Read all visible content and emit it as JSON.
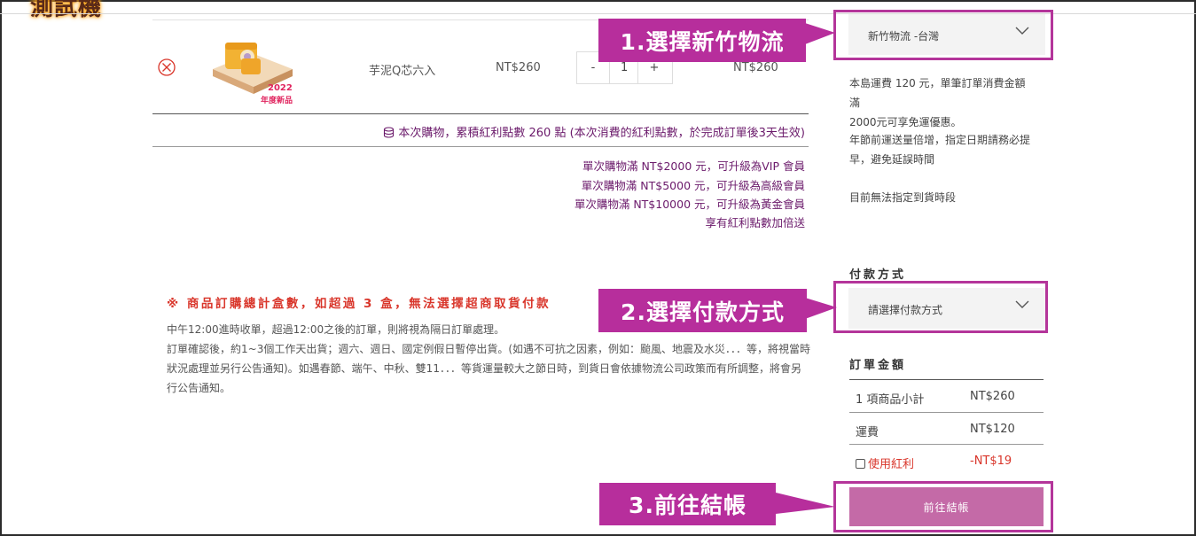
{
  "header": {
    "logo_text": "測試機"
  },
  "cart": {
    "item": {
      "badge_year": "2022",
      "badge_label": "年度新品",
      "name": "芋泥Q芯六入",
      "price": "NT$260",
      "qty_minus": "-",
      "qty_value": "1",
      "qty_plus": "+",
      "subtotal": "NT$260"
    },
    "points_text": "本次購物，累積紅利點數 260 點 (本次消費的紅利點數，於完成訂單後3天生效)",
    "promos": [
      "單次購物滿 NT$2000 元，可升級為VIP 會員",
      "單次購物滿 NT$5000 元，可升級為高級會員",
      "單次購物滿 NT$10000 元，可升級為黃金會員",
      "享有紅利點數加倍送"
    ]
  },
  "notice": {
    "warning": "※ 商品訂購總計盒數，如超過 3 盒，無法選擇超商取貨付款",
    "lines": [
      "中午12:00進時收單，超過12:00之後的訂單，則將視為隔日訂單處理。",
      "訂單確認後，約1~3個工作天出貨；週六、週日、國定例假日暫停出貨。(如遇不可抗之因素，例如：颱風、地震及水災．．．等，將視當時",
      "狀況處理並另行公告通知)。如遇春節、端午、中秋、雙11．．．等貨運量較大之節日時，到貨日會依據物流公司政策而有所調整，將會另",
      "行公告通知。"
    ]
  },
  "shipping": {
    "selected": "新竹物流 -台灣",
    "notes": [
      "本島運費 120 元，單筆訂單消費金額滿",
      "2000元可享免運優惠。",
      "年節前運送量倍增，指定日期請務必提",
      "早，避免延誤時間",
      "目前無法指定到貨時段"
    ]
  },
  "payment": {
    "title": "付款方式",
    "placeholder": "請選擇付款方式"
  },
  "summary": {
    "title": "訂單金額",
    "rows": [
      {
        "label": "1 項商品小計",
        "value": "NT$260"
      },
      {
        "label": "運費",
        "value": "NT$120"
      }
    ],
    "bonus_label": "使用紅利",
    "bonus_value": "-NT$19"
  },
  "checkout": {
    "label": "前往結帳"
  },
  "callouts": {
    "step1": "1.選擇新竹物流",
    "step2": "2.選擇付款方式",
    "step3": "3.前往結帳"
  },
  "colors": {
    "accent": "#b72e9c",
    "promo_text": "#6b1a6b",
    "warning": "#d9362b",
    "checkout_button": "#c46aa7",
    "bonus_red": "#d9362b"
  }
}
